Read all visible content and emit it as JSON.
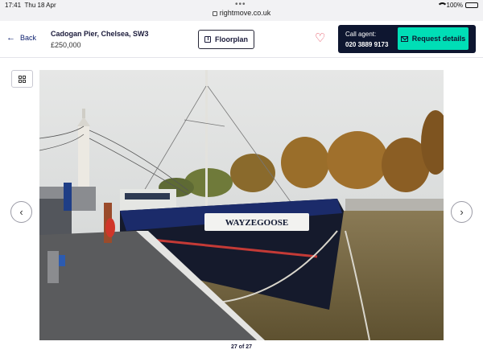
{
  "status_bar": {
    "time": "17:41",
    "date": "Thu 18 Apr",
    "url": "rightmove.co.uk",
    "battery": "100%",
    "battery_level": 1.0
  },
  "header": {
    "back_label": "Back",
    "address": "Cadogan Pier, Chelsea, SW3",
    "price": "£250,000",
    "floorplan_label": "Floorplan",
    "call_agent_label": "Call agent:",
    "agent_phone": "020 3889 9173",
    "request_label": "Request details"
  },
  "gallery": {
    "counter": "27 of 27",
    "boat_name": "WAYZEGOOSE",
    "icons": {
      "back": "arrow-left-icon",
      "floorplan": "floorplan-icon",
      "favourite": "heart-icon",
      "email": "mail-icon",
      "grid": "grid-icon",
      "prev": "chevron-left-icon",
      "next": "chevron-right-icon"
    }
  },
  "colors": {
    "brand_navy": "#0e1630",
    "accent_teal": "#00deb6",
    "heart_red": "#e23a4c"
  }
}
